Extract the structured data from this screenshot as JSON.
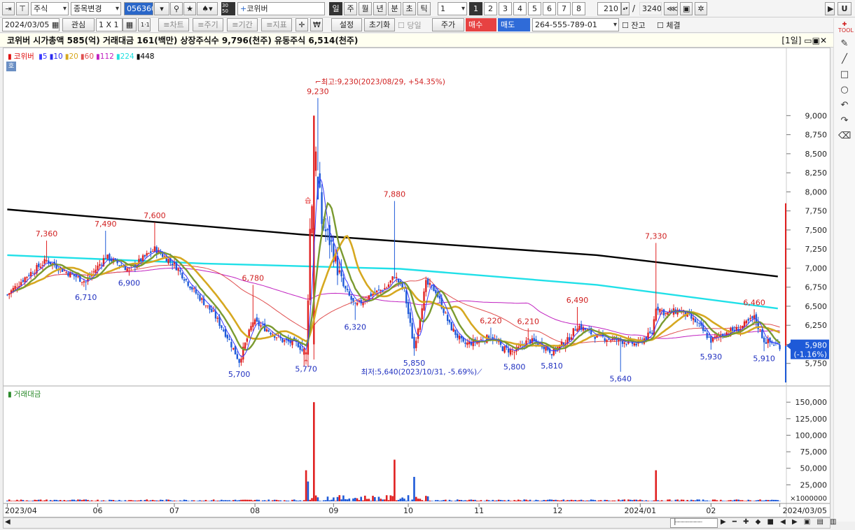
{
  "toolbar1": {
    "market": "주식",
    "change_btn": "종목변경",
    "code": "056360",
    "menu_3050": "30\n50",
    "stock_name": "코위버",
    "periods": [
      "일",
      "주",
      "월",
      "년",
      "분",
      "초",
      "틱"
    ],
    "period_value": "1",
    "pages": [
      "1",
      "2",
      "3",
      "4",
      "5",
      "6",
      "7",
      "8"
    ],
    "count": "210",
    "slash": "/",
    "total": "3240",
    "u_label": "U"
  },
  "toolbar2": {
    "date": "2024/03/05",
    "watch": "관심",
    "layout": "1 X 1",
    "btn_11": "1·1",
    "chart_btn": "≡차트",
    "period_btn": "≡주기",
    "range_btn": "≡기간",
    "indicator_btn": "≡지표",
    "won": "₩",
    "settings": "설정",
    "reset": "초기화",
    "today": "당일",
    "price": "주가",
    "buy": "매수",
    "sell": "매도",
    "account": "264-555-789-01",
    "balance": "잔고",
    "filled": "체결"
  },
  "infobar": {
    "text": "코위버  시가총액 585(억)  거래대금 161(백만)  상장주식수 9,796(천주)  유동주식 6,514(천주)",
    "period": "[1일]"
  },
  "price_legend": {
    "name": "코위버",
    "items": [
      {
        "label": "5",
        "color": "#3a3aff"
      },
      {
        "label": "10",
        "color": "#2a2af0"
      },
      {
        "label": "20",
        "color": "#d6a820"
      },
      {
        "label": "60",
        "color": "#e05050"
      },
      {
        "label": "112",
        "color": "#c020c0"
      },
      {
        "label": "224",
        "color": "#20e0e0"
      },
      {
        "label": "448",
        "color": "#000000"
      }
    ]
  },
  "volume_legend": "거래대금",
  "ho_label": "호",
  "annotations": {
    "high": "최고:9,230(2023/08/29, +54.35%)",
    "low": "최저:5,640(2023/10/31, -5.69%)",
    "current": "5,980",
    "current_change": "(-1.16%)",
    "multiplier": "×1000000",
    "sig_buy": "↑",
    "sig_label": "습"
  },
  "price_labels": [
    {
      "text": "7,360",
      "date_index": 20,
      "value": 7360,
      "color": "#d02020",
      "pos": "above"
    },
    {
      "text": "7,490",
      "date_index": 50,
      "value": 7490,
      "color": "#d02020",
      "pos": "above"
    },
    {
      "text": "7,600",
      "date_index": 75,
      "value": 7600,
      "color": "#d02020",
      "pos": "above"
    },
    {
      "text": "6,780",
      "date_index": 125,
      "value": 6780,
      "color": "#d02020",
      "pos": "above"
    },
    {
      "text": "9,230",
      "date_index": 158,
      "value": 9230,
      "color": "#d02020",
      "pos": "above"
    },
    {
      "text": "7,880",
      "date_index": 197,
      "value": 7880,
      "color": "#d02020",
      "pos": "above"
    },
    {
      "text": "6,220",
      "date_index": 246,
      "value": 6220,
      "color": "#d02020",
      "pos": "above"
    },
    {
      "text": "6,210",
      "date_index": 265,
      "value": 6210,
      "color": "#d02020",
      "pos": "above"
    },
    {
      "text": "6,490",
      "date_index": 290,
      "value": 6490,
      "color": "#d02020",
      "pos": "above"
    },
    {
      "text": "7,330",
      "date_index": 330,
      "value": 7330,
      "color": "#d02020",
      "pos": "above"
    },
    {
      "text": "6,460",
      "date_index": 380,
      "value": 6460,
      "color": "#d02020",
      "pos": "above"
    },
    {
      "text": "6,710",
      "date_index": 40,
      "value": 6710,
      "color": "#2030c0",
      "pos": "below"
    },
    {
      "text": "6,900",
      "date_index": 62,
      "value": 6900,
      "color": "#2030c0",
      "pos": "below"
    },
    {
      "text": "5,700",
      "date_index": 118,
      "value": 5700,
      "color": "#2030c0",
      "pos": "below"
    },
    {
      "text": "5,770",
      "date_index": 152,
      "value": 5770,
      "color": "#2030c0",
      "pos": "below"
    },
    {
      "text": "6,320",
      "date_index": 177,
      "value": 6320,
      "color": "#2030c0",
      "pos": "below"
    },
    {
      "text": "5,850",
      "date_index": 207,
      "value": 5850,
      "color": "#2030c0",
      "pos": "below"
    },
    {
      "text": "5,800",
      "date_index": 258,
      "value": 5800,
      "color": "#2030c0",
      "pos": "below"
    },
    {
      "text": "5,810",
      "date_index": 277,
      "value": 5810,
      "color": "#2030c0",
      "pos": "below"
    },
    {
      "text": "5,640",
      "date_index": 312,
      "value": 5640,
      "color": "#2030c0",
      "pos": "below"
    },
    {
      "text": "5,930",
      "date_index": 358,
      "value": 5930,
      "color": "#2030c0",
      "pos": "below"
    },
    {
      "text": "5,910",
      "date_index": 385,
      "value": 5910,
      "color": "#2030c0",
      "pos": "below"
    }
  ],
  "chart_data": {
    "type": "candlestick",
    "title": "코위버",
    "x_tick_labels": [
      "2023/04",
      "06",
      "07",
      "08",
      "09",
      "10",
      "11",
      "12",
      "2024/01",
      "02",
      "2024/03/05"
    ],
    "x_tick_positions": [
      0,
      46,
      85,
      126,
      166,
      204,
      240,
      280,
      322,
      358,
      393
    ],
    "ylim": [
      5500,
      9700
    ],
    "y_ticks": [
      5750,
      6000,
      6250,
      6500,
      6750,
      7000,
      7250,
      7500,
      7750,
      8000,
      8250,
      8500,
      8750,
      9000
    ],
    "y_tick_labels": [
      "5,750",
      "6,000",
      "6,250",
      "6,500",
      "6,750",
      "7,000",
      "7,250",
      "7,500",
      "7,750",
      "8,000",
      "8,250",
      "8,500",
      "8,750",
      "9,000"
    ],
    "volume_ylim": [
      0,
      165000
    ],
    "volume_ticks": [
      25000,
      50000,
      75000,
      100000,
      125000,
      150000
    ],
    "volume_tick_labels": [
      "25,000",
      "50,000",
      "75,000",
      "100,000",
      "125,000",
      "150,000"
    ],
    "ma_224": [
      [
        0,
        7170
      ],
      [
        100,
        7060
      ],
      [
        200,
        6990
      ],
      [
        300,
        6780
      ],
      [
        392,
        6470
      ]
    ],
    "ma_448": [
      [
        0,
        7770
      ],
      [
        150,
        7440
      ],
      [
        300,
        7170
      ],
      [
        392,
        6890
      ]
    ],
    "volume_spikes": [
      {
        "i": 156,
        "value": 150000,
        "color": "red"
      },
      {
        "i": 152,
        "value": 47000,
        "color": "red"
      },
      {
        "i": 197,
        "value": 63000,
        "color": "red"
      },
      {
        "i": 330,
        "value": 47000,
        "color": "red"
      },
      {
        "i": 207,
        "value": 37000,
        "color": "blue"
      },
      {
        "i": 153,
        "value": 30000,
        "color": "blue"
      }
    ],
    "candles_description": "daily OHLC series; drawn by the script"
  }
}
